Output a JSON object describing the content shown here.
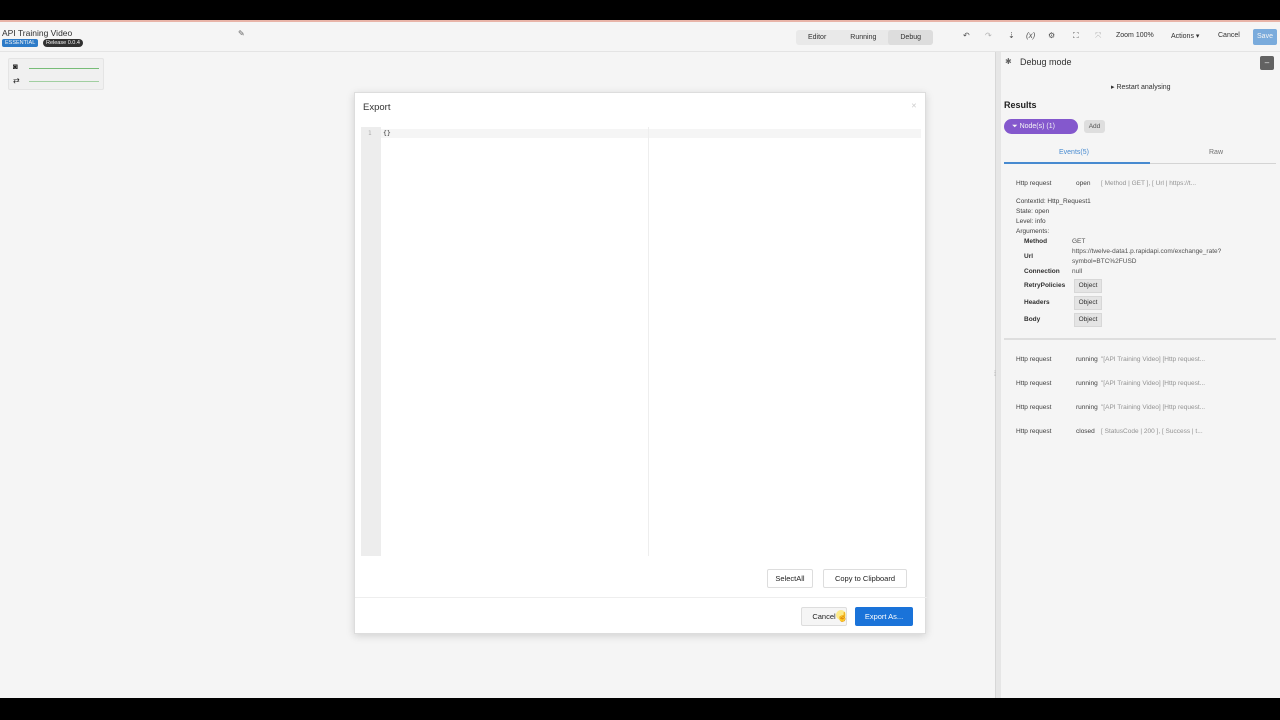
{
  "header": {
    "project_title": "API Training Video",
    "badge_tier": "ESSENTIAL",
    "badge_release": "Release 0.0.4",
    "mode_tabs": [
      {
        "label": "Editor"
      },
      {
        "label": "Running"
      },
      {
        "label": "Debug"
      }
    ],
    "active_tab": "Debug",
    "zoom_label": "Zoom 100%",
    "actions_label": "Actions",
    "cancel_label": "Cancel",
    "save_label": "Save",
    "icons": [
      "undo-icon",
      "redo-icon",
      "import-icon",
      "variables-icon",
      "settings-icon",
      "fullscreen-icon",
      "fit-icon"
    ]
  },
  "debug_panel": {
    "title": "Debug mode",
    "restart_label": "Restart analysing",
    "results_title": "Results",
    "filter_chip": "Node(s)  (1)",
    "add_label": "Add",
    "tabs": {
      "events": "Events(5)",
      "raw": "Raw"
    },
    "first_event": {
      "type": "Http request",
      "state": "open",
      "args": "[ Method | GET ], [ Url | https://t..."
    },
    "details": {
      "context": "ContextId: Http_Request1",
      "state": "State: open",
      "level": "Level: info",
      "arguments": "Arguments:",
      "rows": [
        {
          "key": "Method",
          "value": "GET"
        },
        {
          "key": "Url",
          "value": "https://twelve-data1.p.rapidapi.com/exchange_rate?",
          "value2": "symbol=BTC%2FUSD"
        },
        {
          "key": "Connection",
          "value": "null"
        },
        {
          "key": "RetryPolicies",
          "value": "Object"
        },
        {
          "key": "Headers",
          "value": "Object"
        },
        {
          "key": "Body",
          "value": "Object"
        }
      ]
    },
    "events": [
      {
        "type": "Http request",
        "state": "running",
        "args": "\"[API Training Video] [Http request..."
      },
      {
        "type": "Http request",
        "state": "running",
        "args": "\"[API Training Video] [Http request..."
      },
      {
        "type": "Http request",
        "state": "running",
        "args": "\"[API Training Video] [Http request..."
      },
      {
        "type": "Http request",
        "state": "closed",
        "args": "[ StatusCode | 200 ], [ Success | t..."
      }
    ]
  },
  "modal": {
    "title": "Export",
    "line_number": "1",
    "code": "{}",
    "select_all_label": "SelectAll",
    "copy_label": "Copy to Clipboard",
    "cancel_label": "Cancel",
    "export_label": "Export As..."
  },
  "colors": {
    "primary": "#1a73d9",
    "filter_chip": "#8a5cd6",
    "badge_essential": "#2f80d1"
  }
}
